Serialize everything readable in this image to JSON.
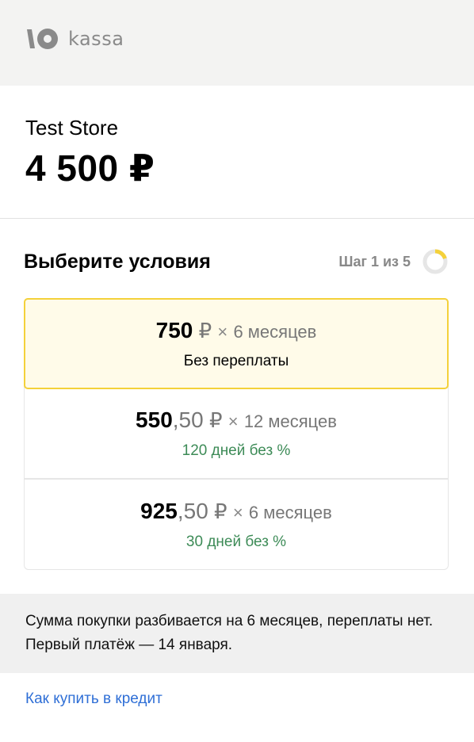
{
  "brand": {
    "name": "kassa",
    "logo_icon": "yoomoney-logo-icon",
    "logo_color": "#8a8a8a"
  },
  "order": {
    "store_name": "Test Store",
    "total": "4 500 ₽"
  },
  "terms": {
    "title": "Выберите условия",
    "step_label": "Шаг 1 из 5",
    "step_progress": 0.2,
    "options": [
      {
        "amount_int": "750",
        "amount_frac": "",
        "currency": "₽",
        "times": "×",
        "months": "6 месяцев",
        "subtitle": "Без переплаты",
        "subtitle_color": "#000000",
        "selected": true
      },
      {
        "amount_int": "550",
        "amount_frac": ",50",
        "currency": "₽",
        "times": "×",
        "months": "12 месяцев",
        "subtitle": "120 дней без %",
        "subtitle_color": "#3d8b57",
        "selected": false
      },
      {
        "amount_int": "925",
        "amount_frac": ",50",
        "currency": "₽",
        "times": "×",
        "months": "6 месяцев",
        "subtitle": "30 дней без %",
        "subtitle_color": "#3d8b57",
        "selected": false
      }
    ]
  },
  "notice": {
    "text": "Сумма покупки разбивается на 6 месяцев, переплаты нет. Первый платёж — 14 января."
  },
  "links": {
    "credit_help": "Как купить в кредит"
  },
  "colors": {
    "accent_yellow": "#f4d13a",
    "selected_bg": "#fffbe9",
    "green": "#3d8b57",
    "link": "#2f6fd6"
  }
}
